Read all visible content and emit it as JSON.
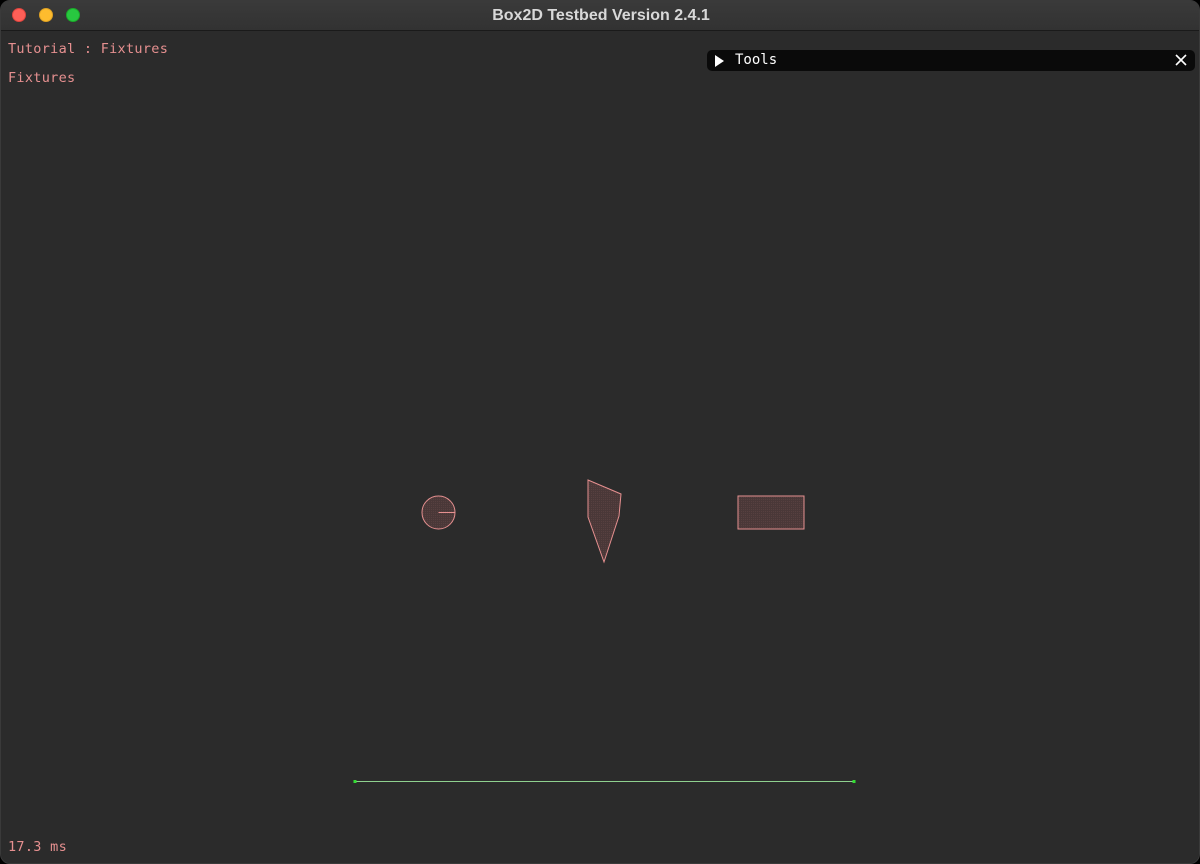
{
  "window": {
    "title": "Box2D Testbed Version 2.4.1"
  },
  "overlay": {
    "test_name": "Tutorial : Fixtures",
    "subtitle": "Fixtures",
    "frame_time": "17.3 ms"
  },
  "tools_panel": {
    "label": "Tools",
    "expand_icon": "triangle-right-icon",
    "close_icon": "close-icon"
  },
  "colors": {
    "overlay_text": "#e69090",
    "body_outline": "#e69090",
    "ground_line": "#8fd18f",
    "ground_endpoint": "#33dd33",
    "canvas_bg": "#2b2b2b"
  }
}
